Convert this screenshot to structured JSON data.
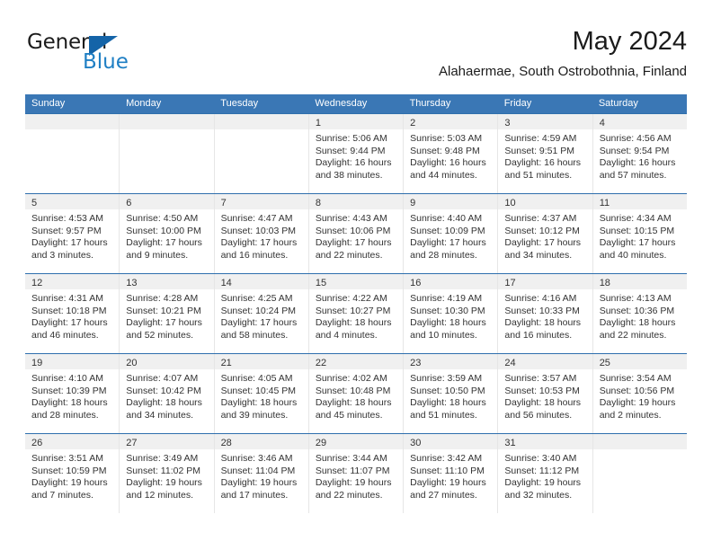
{
  "logo": {
    "word_general": "General",
    "word_blue": "Blue",
    "triangle_color": "#1464a8",
    "blue_color": "#1f7fc4"
  },
  "header": {
    "month_title": "May 2024",
    "location": "Alahaermae, South Ostrobothnia, Finland"
  },
  "theme": {
    "header_blue": "#3a77b5",
    "row_divider_blue": "#2f6fad",
    "date_band_gray": "#f0f0f0"
  },
  "weekdays": [
    "Sunday",
    "Monday",
    "Tuesday",
    "Wednesday",
    "Thursday",
    "Friday",
    "Saturday"
  ],
  "weeks": [
    [
      {
        "day": "",
        "sunrise": "",
        "sunset": "",
        "daylight_line1": "",
        "daylight_line2": ""
      },
      {
        "day": "",
        "sunrise": "",
        "sunset": "",
        "daylight_line1": "",
        "daylight_line2": ""
      },
      {
        "day": "",
        "sunrise": "",
        "sunset": "",
        "daylight_line1": "",
        "daylight_line2": ""
      },
      {
        "day": "1",
        "sunrise": "Sunrise: 5:06 AM",
        "sunset": "Sunset: 9:44 PM",
        "daylight_line1": "Daylight: 16 hours",
        "daylight_line2": "and 38 minutes."
      },
      {
        "day": "2",
        "sunrise": "Sunrise: 5:03 AM",
        "sunset": "Sunset: 9:48 PM",
        "daylight_line1": "Daylight: 16 hours",
        "daylight_line2": "and 44 minutes."
      },
      {
        "day": "3",
        "sunrise": "Sunrise: 4:59 AM",
        "sunset": "Sunset: 9:51 PM",
        "daylight_line1": "Daylight: 16 hours",
        "daylight_line2": "and 51 minutes."
      },
      {
        "day": "4",
        "sunrise": "Sunrise: 4:56 AM",
        "sunset": "Sunset: 9:54 PM",
        "daylight_line1": "Daylight: 16 hours",
        "daylight_line2": "and 57 minutes."
      }
    ],
    [
      {
        "day": "5",
        "sunrise": "Sunrise: 4:53 AM",
        "sunset": "Sunset: 9:57 PM",
        "daylight_line1": "Daylight: 17 hours",
        "daylight_line2": "and 3 minutes."
      },
      {
        "day": "6",
        "sunrise": "Sunrise: 4:50 AM",
        "sunset": "Sunset: 10:00 PM",
        "daylight_line1": "Daylight: 17 hours",
        "daylight_line2": "and 9 minutes."
      },
      {
        "day": "7",
        "sunrise": "Sunrise: 4:47 AM",
        "sunset": "Sunset: 10:03 PM",
        "daylight_line1": "Daylight: 17 hours",
        "daylight_line2": "and 16 minutes."
      },
      {
        "day": "8",
        "sunrise": "Sunrise: 4:43 AM",
        "sunset": "Sunset: 10:06 PM",
        "daylight_line1": "Daylight: 17 hours",
        "daylight_line2": "and 22 minutes."
      },
      {
        "day": "9",
        "sunrise": "Sunrise: 4:40 AM",
        "sunset": "Sunset: 10:09 PM",
        "daylight_line1": "Daylight: 17 hours",
        "daylight_line2": "and 28 minutes."
      },
      {
        "day": "10",
        "sunrise": "Sunrise: 4:37 AM",
        "sunset": "Sunset: 10:12 PM",
        "daylight_line1": "Daylight: 17 hours",
        "daylight_line2": "and 34 minutes."
      },
      {
        "day": "11",
        "sunrise": "Sunrise: 4:34 AM",
        "sunset": "Sunset: 10:15 PM",
        "daylight_line1": "Daylight: 17 hours",
        "daylight_line2": "and 40 minutes."
      }
    ],
    [
      {
        "day": "12",
        "sunrise": "Sunrise: 4:31 AM",
        "sunset": "Sunset: 10:18 PM",
        "daylight_line1": "Daylight: 17 hours",
        "daylight_line2": "and 46 minutes."
      },
      {
        "day": "13",
        "sunrise": "Sunrise: 4:28 AM",
        "sunset": "Sunset: 10:21 PM",
        "daylight_line1": "Daylight: 17 hours",
        "daylight_line2": "and 52 minutes."
      },
      {
        "day": "14",
        "sunrise": "Sunrise: 4:25 AM",
        "sunset": "Sunset: 10:24 PM",
        "daylight_line1": "Daylight: 17 hours",
        "daylight_line2": "and 58 minutes."
      },
      {
        "day": "15",
        "sunrise": "Sunrise: 4:22 AM",
        "sunset": "Sunset: 10:27 PM",
        "daylight_line1": "Daylight: 18 hours",
        "daylight_line2": "and 4 minutes."
      },
      {
        "day": "16",
        "sunrise": "Sunrise: 4:19 AM",
        "sunset": "Sunset: 10:30 PM",
        "daylight_line1": "Daylight: 18 hours",
        "daylight_line2": "and 10 minutes."
      },
      {
        "day": "17",
        "sunrise": "Sunrise: 4:16 AM",
        "sunset": "Sunset: 10:33 PM",
        "daylight_line1": "Daylight: 18 hours",
        "daylight_line2": "and 16 minutes."
      },
      {
        "day": "18",
        "sunrise": "Sunrise: 4:13 AM",
        "sunset": "Sunset: 10:36 PM",
        "daylight_line1": "Daylight: 18 hours",
        "daylight_line2": "and 22 minutes."
      }
    ],
    [
      {
        "day": "19",
        "sunrise": "Sunrise: 4:10 AM",
        "sunset": "Sunset: 10:39 PM",
        "daylight_line1": "Daylight: 18 hours",
        "daylight_line2": "and 28 minutes."
      },
      {
        "day": "20",
        "sunrise": "Sunrise: 4:07 AM",
        "sunset": "Sunset: 10:42 PM",
        "daylight_line1": "Daylight: 18 hours",
        "daylight_line2": "and 34 minutes."
      },
      {
        "day": "21",
        "sunrise": "Sunrise: 4:05 AM",
        "sunset": "Sunset: 10:45 PM",
        "daylight_line1": "Daylight: 18 hours",
        "daylight_line2": "and 39 minutes."
      },
      {
        "day": "22",
        "sunrise": "Sunrise: 4:02 AM",
        "sunset": "Sunset: 10:48 PM",
        "daylight_line1": "Daylight: 18 hours",
        "daylight_line2": "and 45 minutes."
      },
      {
        "day": "23",
        "sunrise": "Sunrise: 3:59 AM",
        "sunset": "Sunset: 10:50 PM",
        "daylight_line1": "Daylight: 18 hours",
        "daylight_line2": "and 51 minutes."
      },
      {
        "day": "24",
        "sunrise": "Sunrise: 3:57 AM",
        "sunset": "Sunset: 10:53 PM",
        "daylight_line1": "Daylight: 18 hours",
        "daylight_line2": "and 56 minutes."
      },
      {
        "day": "25",
        "sunrise": "Sunrise: 3:54 AM",
        "sunset": "Sunset: 10:56 PM",
        "daylight_line1": "Daylight: 19 hours",
        "daylight_line2": "and 2 minutes."
      }
    ],
    [
      {
        "day": "26",
        "sunrise": "Sunrise: 3:51 AM",
        "sunset": "Sunset: 10:59 PM",
        "daylight_line1": "Daylight: 19 hours",
        "daylight_line2": "and 7 minutes."
      },
      {
        "day": "27",
        "sunrise": "Sunrise: 3:49 AM",
        "sunset": "Sunset: 11:02 PM",
        "daylight_line1": "Daylight: 19 hours",
        "daylight_line2": "and 12 minutes."
      },
      {
        "day": "28",
        "sunrise": "Sunrise: 3:46 AM",
        "sunset": "Sunset: 11:04 PM",
        "daylight_line1": "Daylight: 19 hours",
        "daylight_line2": "and 17 minutes."
      },
      {
        "day": "29",
        "sunrise": "Sunrise: 3:44 AM",
        "sunset": "Sunset: 11:07 PM",
        "daylight_line1": "Daylight: 19 hours",
        "daylight_line2": "and 22 minutes."
      },
      {
        "day": "30",
        "sunrise": "Sunrise: 3:42 AM",
        "sunset": "Sunset: 11:10 PM",
        "daylight_line1": "Daylight: 19 hours",
        "daylight_line2": "and 27 minutes."
      },
      {
        "day": "31",
        "sunrise": "Sunrise: 3:40 AM",
        "sunset": "Sunset: 11:12 PM",
        "daylight_line1": "Daylight: 19 hours",
        "daylight_line2": "and 32 minutes."
      },
      {
        "day": "",
        "sunrise": "",
        "sunset": "",
        "daylight_line1": "",
        "daylight_line2": ""
      }
    ]
  ]
}
